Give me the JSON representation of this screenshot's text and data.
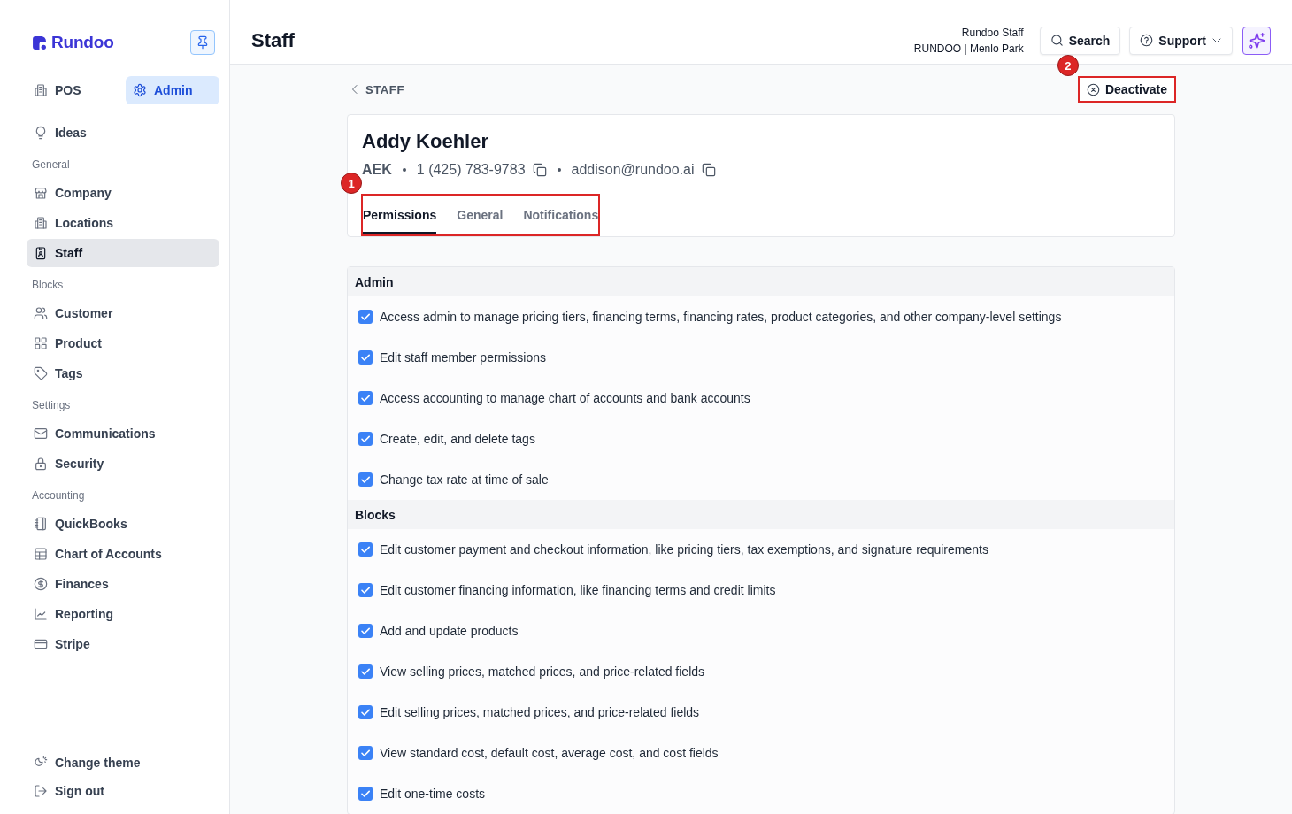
{
  "sidebar": {
    "logo": "Rundoo",
    "modes": [
      {
        "label": "POS",
        "selected": false
      },
      {
        "label": "Admin",
        "selected": true
      }
    ],
    "groups": [
      {
        "items": [
          {
            "label": "Ideas",
            "selected": false
          }
        ]
      },
      {
        "heading": "General",
        "items": [
          {
            "label": "Company",
            "selected": false
          },
          {
            "label": "Locations",
            "selected": false
          },
          {
            "label": "Staff",
            "selected": true
          }
        ]
      },
      {
        "heading": "Blocks",
        "items": [
          {
            "label": "Customer",
            "selected": false
          },
          {
            "label": "Product",
            "selected": false
          },
          {
            "label": "Tags",
            "selected": false
          }
        ]
      },
      {
        "heading": "Settings",
        "items": [
          {
            "label": "Communications",
            "selected": false
          },
          {
            "label": "Security",
            "selected": false
          }
        ]
      },
      {
        "heading": "Accounting",
        "items": [
          {
            "label": "QuickBooks",
            "selected": false
          },
          {
            "label": "Chart of Accounts",
            "selected": false
          },
          {
            "label": "Finances",
            "selected": false
          },
          {
            "label": "Reporting",
            "selected": false
          },
          {
            "label": "Stripe",
            "selected": false
          }
        ]
      }
    ],
    "footer_items": [
      "Change theme",
      "Sign out"
    ]
  },
  "header": {
    "title": "Staff",
    "account": {
      "user": "Rundoo Staff",
      "location": "RUNDOO | Menlo Park"
    },
    "search_button": "Search",
    "support_button": "Support"
  },
  "breadcrumb": {
    "label": "STAFF"
  },
  "deactivate_button": {
    "label": "Deactivate",
    "callout": "2"
  },
  "profile": {
    "name": "Addy Koehler",
    "initials": "AEK",
    "phone": "1 (425) 783-9783",
    "email": "addison@rundoo.ai"
  },
  "tabs": {
    "callout": "1",
    "items": [
      {
        "label": "Permissions",
        "selected": true
      },
      {
        "label": "General",
        "selected": false
      },
      {
        "label": "Notifications",
        "selected": false
      }
    ]
  },
  "permissions": [
    {
      "title": "Admin",
      "items": [
        {
          "label": "Access admin to manage pricing tiers, financing terms, financing rates, product categories, and other company-level settings",
          "checked": true
        },
        {
          "label": "Edit staff member permissions",
          "checked": true
        },
        {
          "label": "Access accounting to manage chart of accounts and bank accounts",
          "checked": true
        },
        {
          "label": "Create, edit, and delete tags",
          "checked": true
        },
        {
          "label": "Change tax rate at time of sale",
          "checked": true
        }
      ]
    },
    {
      "title": "Blocks",
      "items": [
        {
          "label": "Edit customer payment and checkout information, like pricing tiers, tax exemptions, and signature requirements",
          "checked": true
        },
        {
          "label": "Edit customer financing information, like financing terms and credit limits",
          "checked": true
        },
        {
          "label": "Add and update products",
          "checked": true
        },
        {
          "label": "View selling prices, matched prices, and price-related fields",
          "checked": true
        },
        {
          "label": "Edit selling prices, matched prices, and price-related fields",
          "checked": true
        },
        {
          "label": "View standard cost, default cost, average cost, and cost fields",
          "checked": true
        },
        {
          "label": "Edit one-time costs",
          "checked": true
        }
      ]
    }
  ]
}
